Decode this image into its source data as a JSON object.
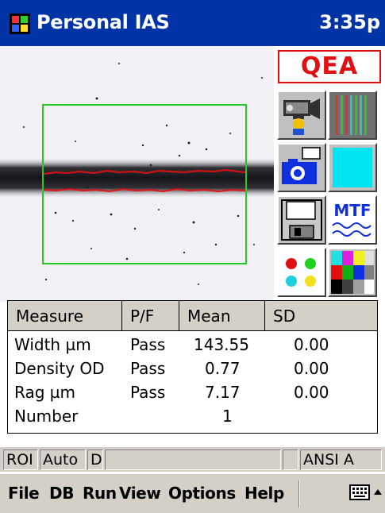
{
  "titlebar": {
    "title": "Personal IAS",
    "clock": "3:35p"
  },
  "brand": "QEA",
  "tools": [
    {
      "name": "video-camera",
      "icon": "video-camera-icon"
    },
    {
      "name": "line-pattern",
      "icon": "color-lines-icon"
    },
    {
      "name": "snapshot-camera",
      "icon": "photo-camera-icon"
    },
    {
      "name": "cyan-swatch",
      "icon": "cyan-square-icon"
    },
    {
      "name": "save-disk",
      "icon": "floppy-disk-icon"
    },
    {
      "name": "mtf",
      "icon": "mtf-wave-icon",
      "label": "MTF"
    },
    {
      "name": "color-dots",
      "icon": "color-dots-icon"
    },
    {
      "name": "color-grid",
      "icon": "color-grid-icon"
    }
  ],
  "table": {
    "headers": [
      "Measure",
      "P/F",
      "Mean",
      "SD"
    ],
    "rows": [
      {
        "measure": "Width µm",
        "pf": "Pass",
        "mean": "143.55",
        "sd": "0.00"
      },
      {
        "measure": "Density OD",
        "pf": "Pass",
        "mean": "0.77",
        "sd": "0.00"
      },
      {
        "measure": "Rag µm",
        "pf": "Pass",
        "mean": "7.17",
        "sd": "0.00"
      },
      {
        "measure": "Number",
        "pf": "",
        "mean": "1",
        "sd": ""
      }
    ]
  },
  "statusbar": {
    "roi": "ROI",
    "mode": "Auto",
    "d": "D",
    "blank1": "",
    "blank2": "",
    "standard": "ANSI A"
  },
  "menu": {
    "items": [
      "File",
      "DB",
      "Run",
      "View",
      "Options",
      "Help"
    ]
  },
  "colors": {
    "titlebar": "#0033a6",
    "roi": "#22cc22",
    "edge": "#e01010",
    "brand": "#e01010"
  }
}
